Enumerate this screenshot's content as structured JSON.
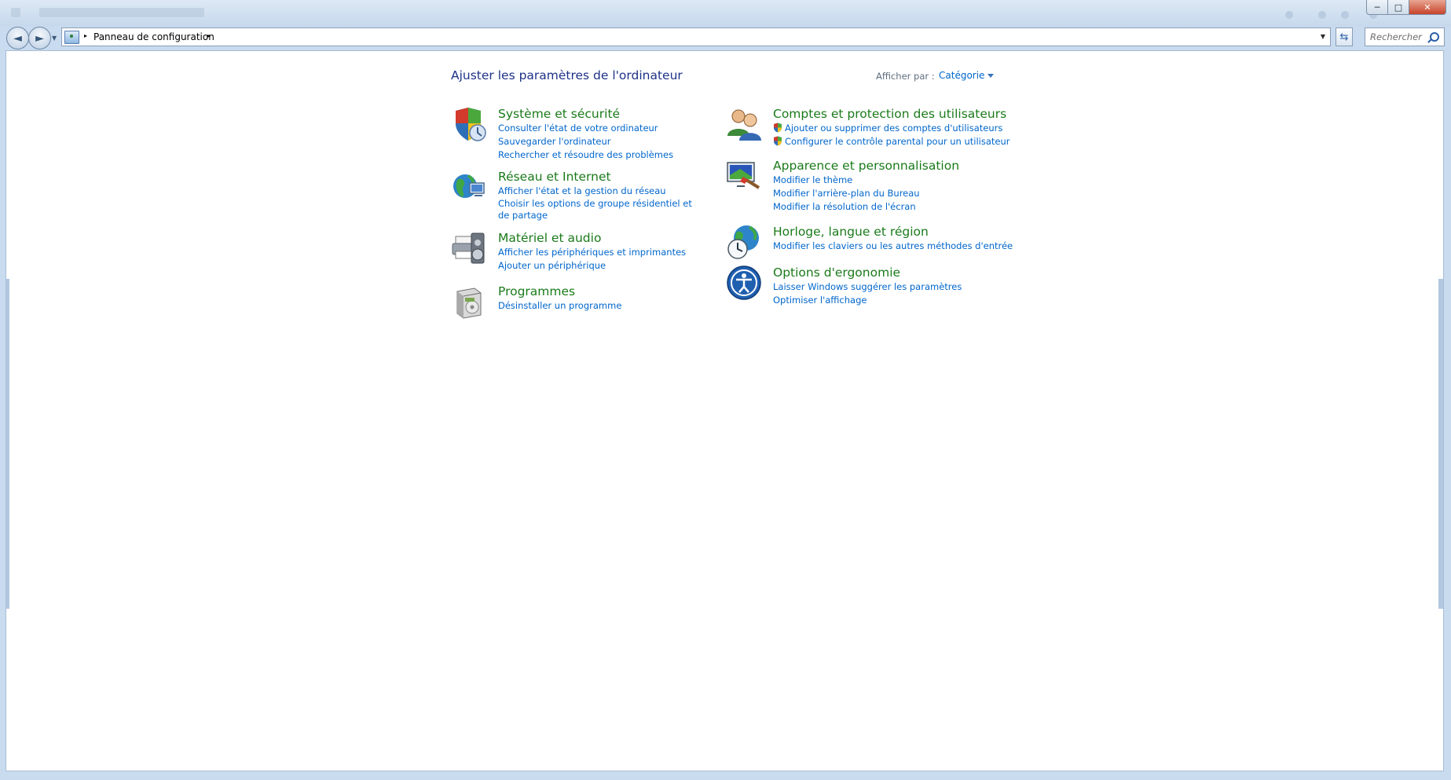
{
  "window": {
    "address": {
      "location_label": "Panneau de configuration",
      "path_separator": "▸"
    },
    "search": {
      "placeholder": "Rechercher"
    },
    "caption": {
      "minimize": "─",
      "maximize": "□",
      "close": "✕"
    }
  },
  "page": {
    "title": "Ajuster les paramètres de l'ordinateur",
    "view_by_label": "Afficher par :",
    "view_by_value": "Catégorie"
  },
  "categories": [
    {
      "title": "Système et sécurité",
      "icon": "security-shield-icon",
      "links": [
        "Consulter l'état de votre ordinateur",
        "Sauvegarder l'ordinateur",
        "Rechercher et résoudre des problèmes"
      ]
    },
    {
      "title": "Réseau et Internet",
      "icon": "network-globe-icon",
      "links": [
        "Afficher l'état et la gestion du réseau",
        "Choisir les options de groupe résidentiel et de partage"
      ]
    },
    {
      "title": "Matériel et audio",
      "icon": "printer-speaker-icon",
      "links": [
        "Afficher les périphériques et imprimantes",
        "Ajouter un périphérique"
      ]
    },
    {
      "title": "Programmes",
      "icon": "programs-box-icon",
      "links": [
        "Désinstaller un programme"
      ]
    },
    {
      "title": "Comptes et protection des utilisateurs",
      "icon": "users-icon",
      "links": [
        "Ajouter ou supprimer des comptes d'utilisateurs",
        "Configurer le contrôle parental pour un utilisateur"
      ]
    },
    {
      "title": "Apparence et personnalisation",
      "icon": "display-paint-icon",
      "links": [
        "Modifier le thème",
        "Modifier l'arrière-plan du Bureau",
        "Modifier la résolution de l'écran"
      ]
    },
    {
      "title": "Horloge, langue et région",
      "icon": "globe-clock-icon",
      "links": [
        "Modifier les claviers ou les autres méthodes d'entrée"
      ]
    },
    {
      "title": "Options d'ergonomie",
      "icon": "ease-of-access-icon",
      "links": [
        "Laisser Windows suggérer les paramètres",
        "Optimiser l'affichage"
      ]
    }
  ],
  "colors": {
    "category_title": "#1a7a1a",
    "link": "#0066cc",
    "page_title": "#1e3287",
    "window_frame": "#c9dcef"
  }
}
